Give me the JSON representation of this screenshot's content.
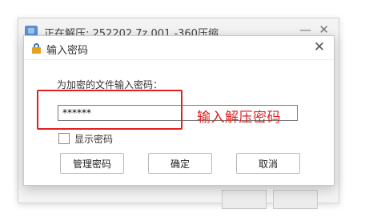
{
  "background_window": {
    "title": "正在解压: 252202.7z.001 -360压缩",
    "minimize_glyph": "—",
    "close_glyph": "✕"
  },
  "dialog": {
    "title": "输入密码",
    "close_glyph": "✕",
    "prompt": "为加密的文件输入密码：",
    "password_value": "******",
    "show_password_label": "显示密码",
    "buttons": {
      "manage": "管理密码",
      "ok": "确定",
      "cancel": "取消"
    }
  },
  "annotation": {
    "text": "输入解压密码",
    "color": "#e02020"
  },
  "icons": {
    "background_window": "archive-icon",
    "dialog": "lock-icon"
  }
}
